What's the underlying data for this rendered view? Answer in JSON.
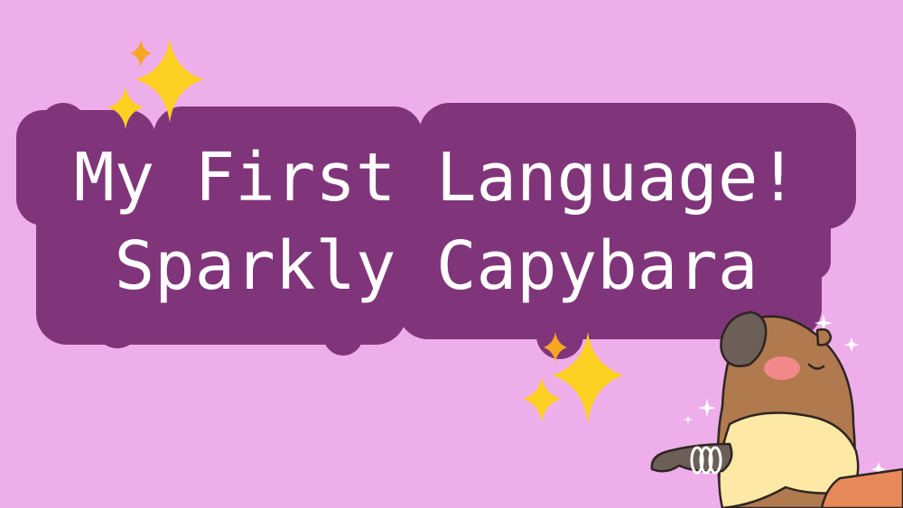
{
  "colors": {
    "background": "#eeaeea",
    "title_bubble": "#80357a",
    "title_bubble_halo": "#9a4a93",
    "title_text": "#ffffff",
    "sparkle_gold": "#fdd024",
    "sparkle_orange": "#f5a623",
    "capybara_fur": "#b07a4e",
    "capybara_face": "#6b5f58",
    "capybara_blush": "#f2888a",
    "shirt": "#fde9a5",
    "skirt": "#e8895a"
  },
  "title": {
    "line1": "My First Language!",
    "line2": "Sparkly Capybara"
  },
  "decorations": {
    "sparkle_icon": "sparkle-icon",
    "mascot_icon": "capybara-icon"
  }
}
